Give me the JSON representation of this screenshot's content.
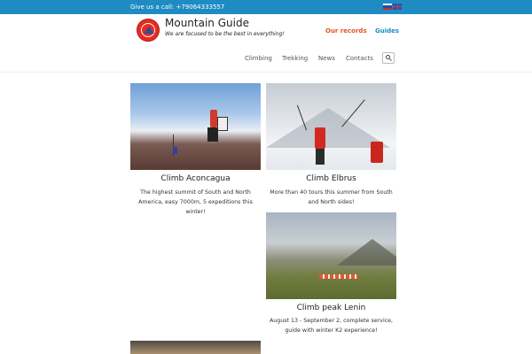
{
  "topbar": {
    "call_text": "Give us a call: +79064333557",
    "languages": [
      "ru-flag-icon",
      "en-flag-icon"
    ]
  },
  "header": {
    "site_title": "Mountain Guide",
    "tagline": "We are focused to be the best in everything!",
    "top_links": [
      "Our records",
      "Guides"
    ]
  },
  "nav": {
    "items": [
      "Climbing",
      "Trekking",
      "News",
      "Contacts"
    ],
    "search_icon": "search-icon"
  },
  "colors": {
    "topbar": "#1e8bc3",
    "records_link": "#e2552a",
    "guides_link": "#1e8bc3"
  },
  "cards": [
    {
      "title": "Climb Aconcagua",
      "description": "The highest summit of South and North America, easy 7000m, 5 expeditions this winter!"
    },
    {
      "title": "Climb Elbrus",
      "description": "More than 40 tours this summer from South and North sides!"
    },
    {
      "title": "Climb peak Lenin",
      "description": "August 13 - September 2, complete service, guide with winter K2 experience!"
    }
  ]
}
